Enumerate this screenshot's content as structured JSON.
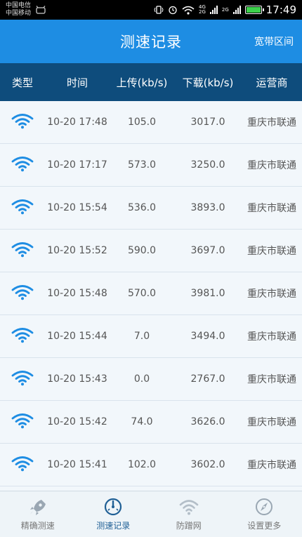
{
  "status_bar": {
    "carrier_1": "中国电信",
    "carrier_2": "中国移动",
    "net_top": "4G",
    "net_bottom": "2G",
    "net_2": "2G",
    "time": "17:49"
  },
  "header": {
    "title": "测速记录",
    "action": "宽带区间"
  },
  "table": {
    "columns": [
      "类型",
      "时间",
      "上传(kb/s)",
      "下载(kb/s)",
      "运营商"
    ],
    "rows": [
      {
        "time": "10-20 17:48",
        "upload": "105.0",
        "download": "3017.0",
        "isp": "重庆市联通"
      },
      {
        "time": "10-20 17:17",
        "upload": "573.0",
        "download": "3250.0",
        "isp": "重庆市联通"
      },
      {
        "time": "10-20 15:54",
        "upload": "536.0",
        "download": "3893.0",
        "isp": "重庆市联通"
      },
      {
        "time": "10-20 15:52",
        "upload": "590.0",
        "download": "3697.0",
        "isp": "重庆市联通"
      },
      {
        "time": "10-20 15:48",
        "upload": "570.0",
        "download": "3981.0",
        "isp": "重庆市联通"
      },
      {
        "time": "10-20 15:44",
        "upload": "7.0",
        "download": "3494.0",
        "isp": "重庆市联通"
      },
      {
        "time": "10-20 15:43",
        "upload": "0.0",
        "download": "2767.0",
        "isp": "重庆市联通"
      },
      {
        "time": "10-20 15:42",
        "upload": "74.0",
        "download": "3626.0",
        "isp": "重庆市联通"
      },
      {
        "time": "10-20 15:41",
        "upload": "102.0",
        "download": "3602.0",
        "isp": "重庆市联通"
      }
    ],
    "row_icon": "wifi-icon"
  },
  "bottom_nav": [
    {
      "label": "精确测速",
      "icon": "rocket-icon",
      "active": false
    },
    {
      "label": "测速记录",
      "icon": "speedometer-icon",
      "active": true
    },
    {
      "label": "防蹭网",
      "icon": "wifi-icon",
      "active": false
    },
    {
      "label": "设置更多",
      "icon": "compass-icon",
      "active": false
    }
  ],
  "colors": {
    "header_bg": "#1e8de3",
    "table_head_bg": "#0e4c7c",
    "wifi_blue": "#1e8de3",
    "nav_active": "#1f5f95"
  }
}
